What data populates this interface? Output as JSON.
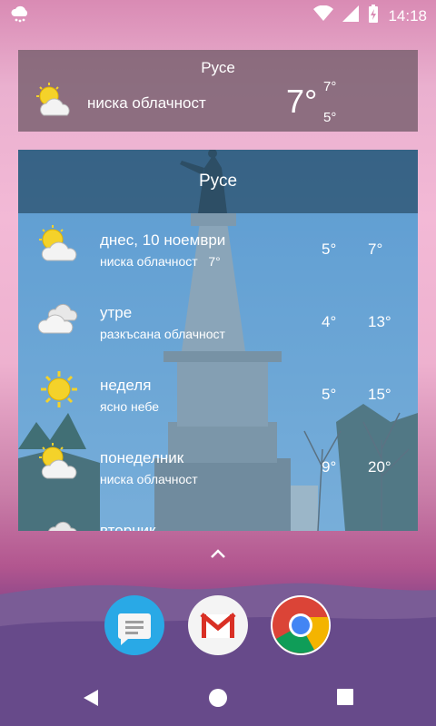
{
  "status_bar": {
    "time": "14:18",
    "left_icon": "weather-cloud-rain-icon",
    "icons": [
      "wifi-icon",
      "signal-icon",
      "battery-charging-icon"
    ]
  },
  "small_widget": {
    "city": "Русе",
    "description": "ниска облачност",
    "temperature": "7°",
    "high": "7°",
    "low": "5°",
    "icon": "sun-behind-cloud-icon"
  },
  "forecast_widget": {
    "city": "Русе",
    "rows": [
      {
        "day": "днес, 10 ноември",
        "condition": "ниска облачност",
        "extra": "7°",
        "low": "5°",
        "high": "7°",
        "icon": "sun-behind-cloud-icon"
      },
      {
        "day": "утре",
        "condition": "разкъсана облачност",
        "extra": "",
        "low": "4°",
        "high": "13°",
        "icon": "clouds-icon"
      },
      {
        "day": "неделя",
        "condition": "ясно небе",
        "extra": "",
        "low": "5°",
        "high": "15°",
        "icon": "sun-icon"
      },
      {
        "day": "понеделник",
        "condition": "ниска облачност",
        "extra": "",
        "low": "9°",
        "high": "20°",
        "icon": "sun-behind-cloud-icon"
      },
      {
        "day": "вторник",
        "condition": "",
        "extra": "",
        "low": "",
        "high": "",
        "icon": "clouds-icon"
      }
    ]
  },
  "dock": {
    "apps": [
      "messages-app-icon",
      "gmail-app-icon",
      "chrome-app-icon"
    ]
  },
  "nav_bar": {
    "buttons": [
      "back-button",
      "home-button",
      "recents-button"
    ]
  }
}
